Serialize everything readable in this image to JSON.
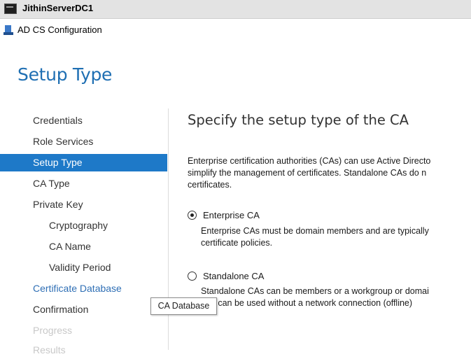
{
  "window": {
    "title": "JithinServerDC1"
  },
  "app": {
    "title": "AD CS Configuration"
  },
  "page": {
    "title": "Setup Type"
  },
  "nav": {
    "items": [
      {
        "label": "Credentials",
        "state": "normal"
      },
      {
        "label": "Role Services",
        "state": "normal"
      },
      {
        "label": "Setup Type",
        "state": "active"
      },
      {
        "label": "CA Type",
        "state": "normal"
      },
      {
        "label": "Private Key",
        "state": "normal"
      },
      {
        "label": "Cryptography",
        "state": "sub"
      },
      {
        "label": "CA Name",
        "state": "sub"
      },
      {
        "label": "Validity Period",
        "state": "sub"
      },
      {
        "label": "Certificate Database",
        "state": "link"
      },
      {
        "label": "Confirmation",
        "state": "normal"
      },
      {
        "label": "Progress",
        "state": "disabled"
      },
      {
        "label": "Results",
        "state": "disabled"
      }
    ]
  },
  "content": {
    "heading": "Specify the setup type of the CA",
    "description": [
      "Enterprise certification authorities (CAs) can use Active Directo",
      "simplify the management of certificates. Standalone CAs do n",
      "certificates."
    ],
    "options": [
      {
        "label": "Enterprise CA",
        "checked": true,
        "description": [
          "Enterprise CAs must be domain members and are typically",
          "certificate policies."
        ]
      },
      {
        "label": "Standalone CA",
        "checked": false,
        "description": [
          "Standalone CAs can be members or a workgroup or domai",
          "and can be used without a network connection (offline)"
        ]
      }
    ]
  },
  "tooltip": {
    "text": "CA Database"
  },
  "colors": {
    "accent": "#1e79c8",
    "title_blue": "#1f6fb3",
    "link_blue": "#2f6fb5",
    "disabled": "#c8c8c8"
  }
}
